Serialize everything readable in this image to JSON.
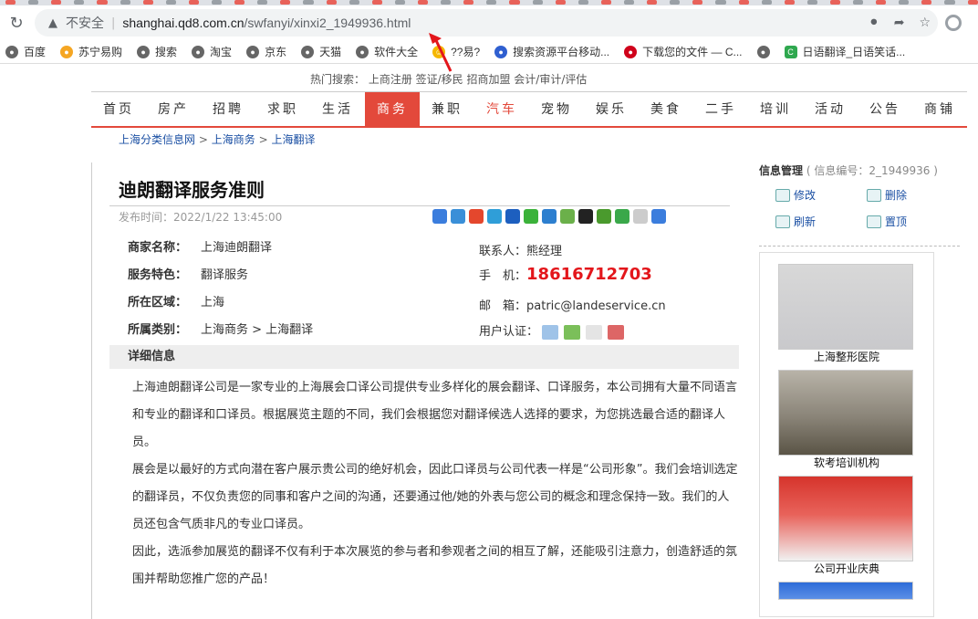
{
  "browser": {
    "security_label": "不安全",
    "url_host": "shanghai.qd8.com.cn",
    "url_path": "/swfanyi/xinxi2_1949936.html"
  },
  "bookmarks": [
    {
      "label": "百度",
      "icon": "globe-icon"
    },
    {
      "label": "苏宁易购",
      "icon": "suning-icon"
    },
    {
      "label": "搜索",
      "icon": "globe-icon"
    },
    {
      "label": "淘宝",
      "icon": "globe-icon"
    },
    {
      "label": "京东",
      "icon": "globe-icon"
    },
    {
      "label": "天猫",
      "icon": "globe-icon"
    },
    {
      "label": "软件大全",
      "icon": "globe-icon"
    },
    {
      "label": "??易?",
      "icon": "smile-icon"
    },
    {
      "label": "搜索资源平台移动...",
      "icon": "paw-icon"
    },
    {
      "label": "下载您的文件 — C...",
      "icon": "red-circle-icon"
    },
    {
      "label": "",
      "icon": "globe-icon"
    },
    {
      "label": "日语翻译_日语笑话...",
      "icon": "green-c-icon"
    }
  ],
  "site": {
    "hot_search": "热门搜索：  上商注册  签证/移民  招商加盟  会计/审计/评估",
    "nav": [
      "首页",
      "房产",
      "招聘",
      "求职",
      "生活",
      "商务",
      "兼职",
      "汽车",
      "宠物",
      "娱乐",
      "美食",
      "二手",
      "培训",
      "活动",
      "公告",
      "商铺"
    ],
    "breadcrumb": [
      "上海分类信息网",
      "上海商务",
      "上海翻译"
    ],
    "breadcrumb_sep": ">"
  },
  "post": {
    "title": "迪朗翻译服务准则",
    "published": "发布时间：2022/1/22 13:45:00",
    "fields": [
      {
        "key": "商家名称：",
        "value": "上海迪朗翻译"
      },
      {
        "key": "服务特色：",
        "value": "翻译服务"
      },
      {
        "key": "所在区域：",
        "value": "上海"
      },
      {
        "key": "所属类别：",
        "value": "上海商务 > 上海翻译"
      }
    ],
    "contact_label": "联系人：",
    "contact_name": "熊经理",
    "phone_label": "手　机：",
    "phone": "18616712703",
    "email_label": "邮　箱：",
    "email": "patric@landeservice.cn",
    "cert_label": "用户认证：",
    "detail_heading": "详细信息",
    "paragraphs": [
      "上海迪朗翻译公司是一家专业的上海展会口译公司提供专业多样化的展会翻译、口译服务，本公司拥有大量不同语言和专业的翻译和口译员。根据展览主题的不同，我们会根据您对翻译候选人选择的要求，为您挑选最合适的翻译人员。",
      "展会是以最好的方式向潜在客户展示贵公司的绝好机会，因此口译员与公司代表一样是“公司形象”。我们会培训选定的翻译员，不仅负责您的同事和客户之间的沟通，还要通过他/她的外表与您公司的概念和理念保持一致。我们的人员还包含气质非凡的专业口译员。",
      "因此，选派参加展览的翻译不仅有利于本次展览的参与者和参观者之间的相互了解，还能吸引注意力，创造舒适的氛围并帮助您推广您的产品！"
    ]
  },
  "sidebar": {
    "heading": "信息管理",
    "info_id": "( 信息编号：2_1949936 )",
    "actions": [
      "修改",
      "删除",
      "刷新",
      "置顶"
    ],
    "ads": [
      "上海整形医院",
      "软考培训机构",
      "公司开业庆典"
    ]
  }
}
